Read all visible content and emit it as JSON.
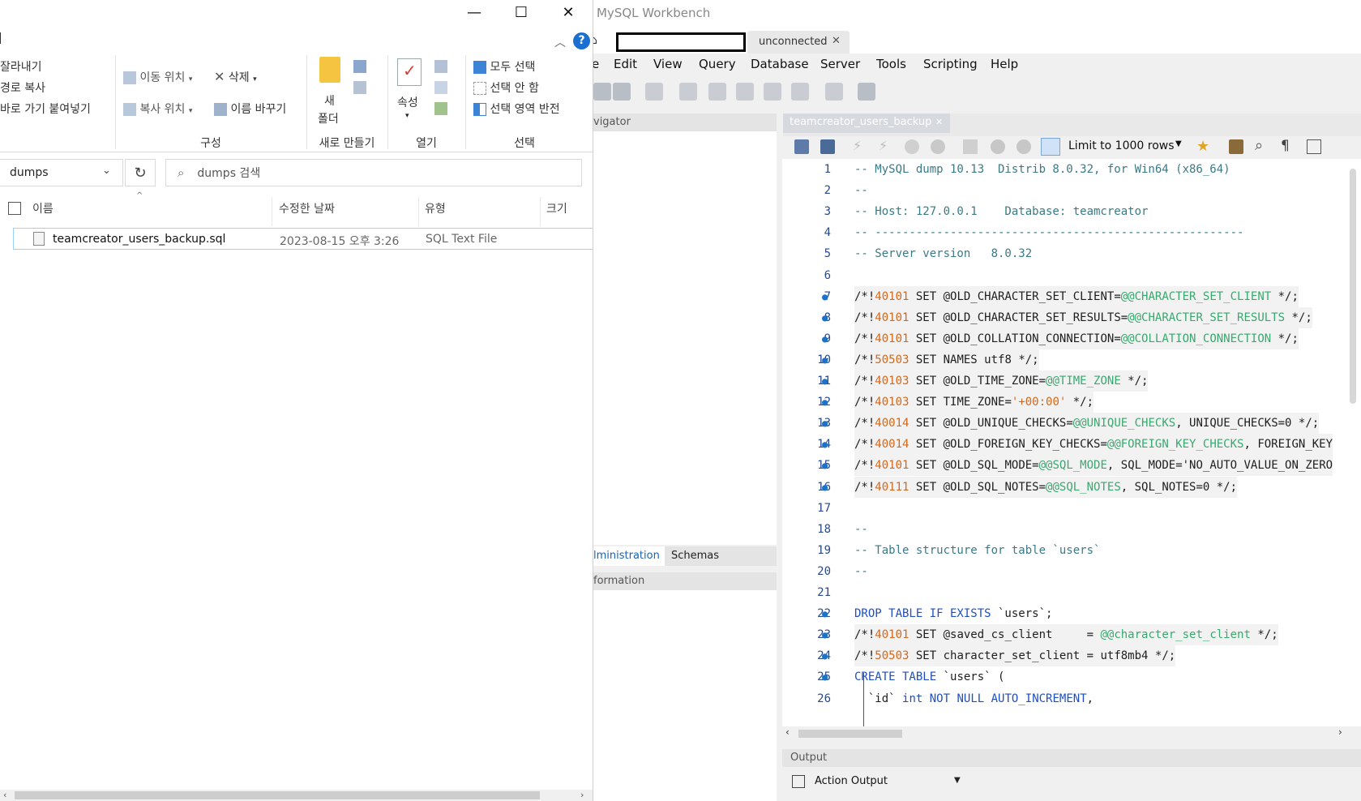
{
  "explorer": {
    "window_controls": {
      "minimize": "—",
      "maximize": "☐",
      "close": "✕"
    },
    "help": "?",
    "ribbon": {
      "clipboard": {
        "cut": "잘라내기",
        "copy_path": "경로 복사",
        "paste_shortcut": "바로 가기 붙여넣기"
      },
      "organize": {
        "move_to": "이동 위치",
        "delete": "삭제",
        "copy_to": "복사 위치",
        "rename": "이름 바꾸기",
        "label": "구성"
      },
      "new": {
        "new_folder_line1": "새",
        "new_folder_line2": "폴더",
        "label": "새로 만들기"
      },
      "open": {
        "properties": "속성",
        "label": "열기"
      },
      "select": {
        "select_all": "모두 선택",
        "select_none": "선택 안 함",
        "invert": "선택 영역 반전",
        "label": "선택"
      }
    },
    "address": "dumps",
    "search_placeholder": "dumps 검색",
    "columns": {
      "name": "이름",
      "modified": "수정한 날짜",
      "type": "유형",
      "size": "크기"
    },
    "files": [
      {
        "name": "teamcreator_users_backup.sql",
        "modified": "2023-08-15 오후 3:26",
        "type": "SQL Text File"
      }
    ]
  },
  "workbench": {
    "title": "MySQL Workbench",
    "tab_label": "unconnected",
    "menu": [
      "e",
      "Edit",
      "View",
      "Query",
      "Database",
      "Server",
      "Tools",
      "Scripting",
      "Help"
    ],
    "navigator_label": "vigator",
    "bottom_tabs": {
      "administration": "lministration",
      "schemas": "Schemas"
    },
    "information_label": "formation",
    "editor_tab": "teamcreator_users_backup",
    "limit_rows": "Limit to 1000 rows",
    "output_label": "Output",
    "action_output": "Action Output",
    "code_lines": [
      {
        "n": "1",
        "dot": false,
        "text": "-- MySQL dump 10.13  Distrib 8.0.32, for Win64 (x86_64)"
      },
      {
        "n": "2",
        "dot": false,
        "text": "--"
      },
      {
        "n": "3",
        "dot": false,
        "text": "-- Host: 127.0.0.1    Database: teamcreator"
      },
      {
        "n": "4",
        "dot": false,
        "text": "-- ------------------------------------------------------"
      },
      {
        "n": "5",
        "dot": false,
        "text": "-- Server version\t8.0.32"
      },
      {
        "n": "6",
        "dot": false,
        "text": ""
      },
      {
        "n": "7",
        "dot": true,
        "text": "/*!40101 SET @OLD_CHARACTER_SET_CLIENT=@@CHARACTER_SET_CLIENT */;"
      },
      {
        "n": "8",
        "dot": true,
        "text": "/*!40101 SET @OLD_CHARACTER_SET_RESULTS=@@CHARACTER_SET_RESULTS */;"
      },
      {
        "n": "9",
        "dot": true,
        "text": "/*!40101 SET @OLD_COLLATION_CONNECTION=@@COLLATION_CONNECTION */;"
      },
      {
        "n": "10",
        "dot": true,
        "text": "/*!50503 SET NAMES utf8 */;"
      },
      {
        "n": "11",
        "dot": true,
        "text": "/*!40103 SET @OLD_TIME_ZONE=@@TIME_ZONE */;"
      },
      {
        "n": "12",
        "dot": true,
        "text": "/*!40103 SET TIME_ZONE='+00:00' */;"
      },
      {
        "n": "13",
        "dot": true,
        "text": "/*!40014 SET @OLD_UNIQUE_CHECKS=@@UNIQUE_CHECKS, UNIQUE_CHECKS=0 */;"
      },
      {
        "n": "14",
        "dot": true,
        "text": "/*!40014 SET @OLD_FOREIGN_KEY_CHECKS=@@FOREIGN_KEY_CHECKS, FOREIGN_KEY"
      },
      {
        "n": "15",
        "dot": true,
        "text": "/*!40101 SET @OLD_SQL_MODE=@@SQL_MODE, SQL_MODE='NO_AUTO_VALUE_ON_ZERO"
      },
      {
        "n": "16",
        "dot": true,
        "text": "/*!40111 SET @OLD_SQL_NOTES=@@SQL_NOTES, SQL_NOTES=0 */;"
      },
      {
        "n": "17",
        "dot": false,
        "text": ""
      },
      {
        "n": "18",
        "dot": false,
        "text": "--"
      },
      {
        "n": "19",
        "dot": false,
        "text": "-- Table structure for table `users`"
      },
      {
        "n": "20",
        "dot": false,
        "text": "--"
      },
      {
        "n": "21",
        "dot": false,
        "text": ""
      },
      {
        "n": "22",
        "dot": true,
        "text": "DROP TABLE IF EXISTS `users`;"
      },
      {
        "n": "23",
        "dot": true,
        "text": "/*!40101 SET @saved_cs_client     = @@character_set_client */;"
      },
      {
        "n": "24",
        "dot": true,
        "text": "/*!50503 SET character_set_client = utf8mb4 */;"
      },
      {
        "n": "25",
        "dot": true,
        "text": "CREATE TABLE `users` ("
      },
      {
        "n": "26",
        "dot": false,
        "text": "  `id` int NOT NULL AUTO_INCREMENT,"
      }
    ]
  }
}
